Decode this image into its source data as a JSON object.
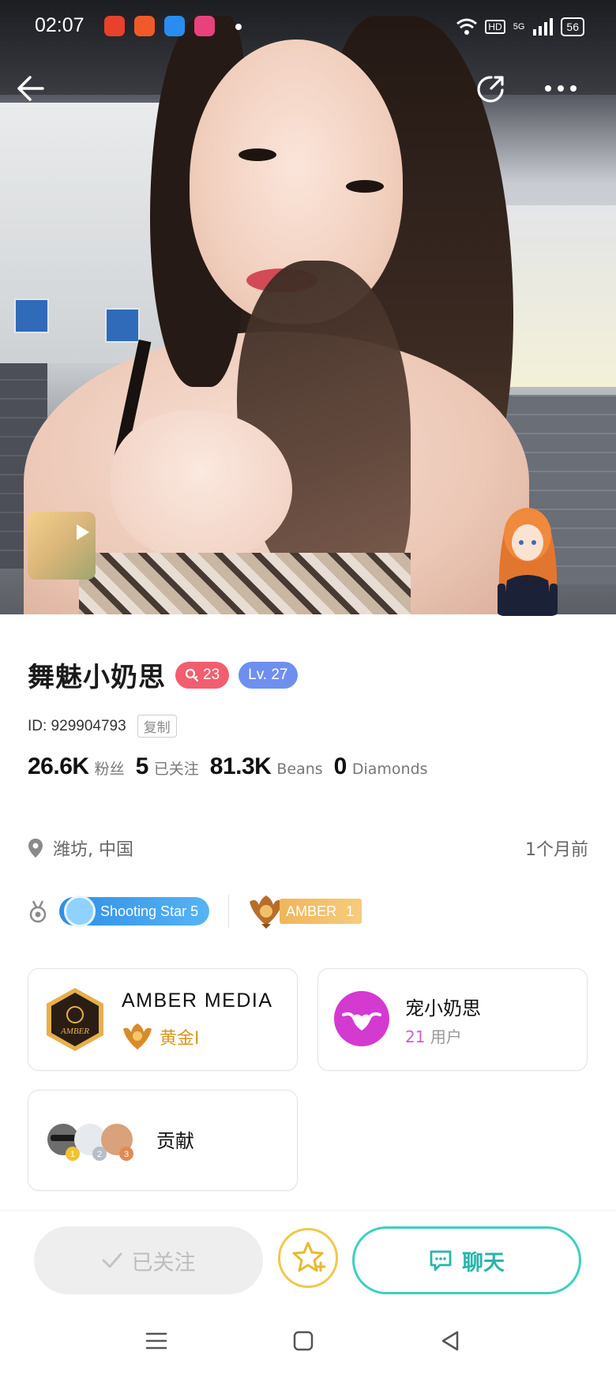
{
  "status_bar": {
    "time": "02:07",
    "network_label": "HD",
    "signal_label": "5G",
    "battery": "56"
  },
  "profile": {
    "name": "舞魅小奶思",
    "fan_level_badge": "23",
    "level_badge": "Lv. 27",
    "id_text": "ID: 929904793",
    "copy_label": "复制",
    "stats": [
      {
        "value": "26.6K",
        "label": "粉丝"
      },
      {
        "value": "5",
        "label": "已关注"
      },
      {
        "value": "81.3K",
        "label": "Beans"
      },
      {
        "value": "0",
        "label": "Diamonds"
      }
    ],
    "location": "潍坊, 中国",
    "last_active": "1个月前",
    "medals": {
      "shooting_star": "Shooting Star 5",
      "amber_name": "AMBER",
      "amber_rank": "1"
    }
  },
  "cards": {
    "agency": {
      "name": "AMBER MEDIA",
      "rank": "黄金I",
      "logo_text": "AMBER"
    },
    "fan_club": {
      "name": "宠小奶思",
      "count": "21",
      "count_suffix": "用户"
    },
    "contribution": {
      "label": "贡献",
      "ranks": [
        "1",
        "2",
        "3"
      ]
    }
  },
  "actions": {
    "followed_label": "已关注",
    "chat_label": "聊天"
  },
  "colors": {
    "fan_badge": "#f25e6f",
    "level_badge": "#6f8ff0",
    "chat_accent": "#3ecfc2",
    "star_ring": "#f0c84b",
    "gold_rank": "#d9961e"
  }
}
